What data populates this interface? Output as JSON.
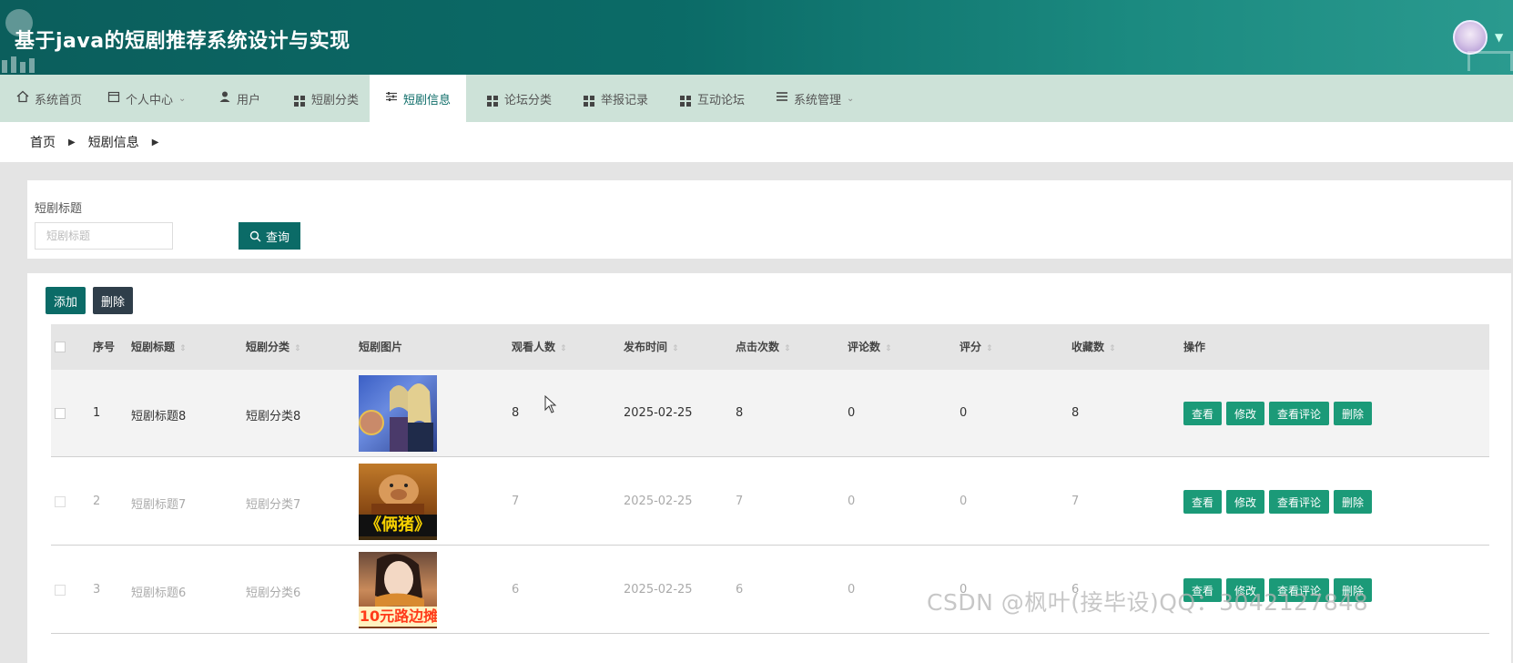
{
  "header": {
    "title": "基于java的短剧推荐系统设计与实现"
  },
  "nav": {
    "items": [
      {
        "label": "系统首页",
        "icon": "home-icon"
      },
      {
        "label": "个人中心",
        "icon": "calendar-icon"
      },
      {
        "label": "用户",
        "icon": "user-icon"
      },
      {
        "label": "短剧分类",
        "icon": "grid-icon"
      },
      {
        "label": "短剧信息",
        "icon": "sliders-icon"
      },
      {
        "label": "论坛分类",
        "icon": "grid-icon"
      },
      {
        "label": "举报记录",
        "icon": "grid-icon"
      },
      {
        "label": "互动论坛",
        "icon": "grid-icon"
      },
      {
        "label": "系统管理",
        "icon": "list-icon"
      }
    ],
    "active_label": "短剧信息"
  },
  "breadcrumb": {
    "home": "首页",
    "current": "短剧信息"
  },
  "search": {
    "label": "短剧标题",
    "placeholder": "短剧标题",
    "button": "查询"
  },
  "toolbar": {
    "add": "添加",
    "delete": "删除"
  },
  "table": {
    "headers": {
      "index": "序号",
      "title": "短剧标题",
      "category": "短剧分类",
      "image": "短剧图片",
      "viewers": "观看人数",
      "publish_time": "发布时间",
      "clicks": "点击次数",
      "comments": "评论数",
      "score": "评分",
      "favorites": "收藏数",
      "actions": "操作"
    },
    "rows": [
      {
        "index": "1",
        "title": "短剧标题8",
        "category": "短剧分类8",
        "image_caption": "",
        "viewers": "8",
        "publish_time": "2025-02-25",
        "clicks": "8",
        "comments": "0",
        "score": "0",
        "favorites": "8"
      },
      {
        "index": "2",
        "title": "短剧标题7",
        "category": "短剧分类7",
        "image_caption": "《俩猪》",
        "viewers": "7",
        "publish_time": "2025-02-25",
        "clicks": "7",
        "comments": "0",
        "score": "0",
        "favorites": "7"
      },
      {
        "index": "3",
        "title": "短剧标题6",
        "category": "短剧分类6",
        "image_caption": "10元路边摊",
        "viewers": "6",
        "publish_time": "2025-02-25",
        "clicks": "6",
        "comments": "0",
        "score": "0",
        "favorites": "6"
      }
    ],
    "actions": {
      "view": "查看",
      "edit": "修改",
      "view_comments": "查看评论",
      "delete": "删除"
    }
  },
  "watermark": "CSDN @枫叶(接毕设)QQ：3042127848",
  "colors": {
    "primary": "#0b6b67",
    "action": "#1b9a78",
    "nav_bg": "#cde2d8",
    "dark_button": "#2f3e4a"
  }
}
